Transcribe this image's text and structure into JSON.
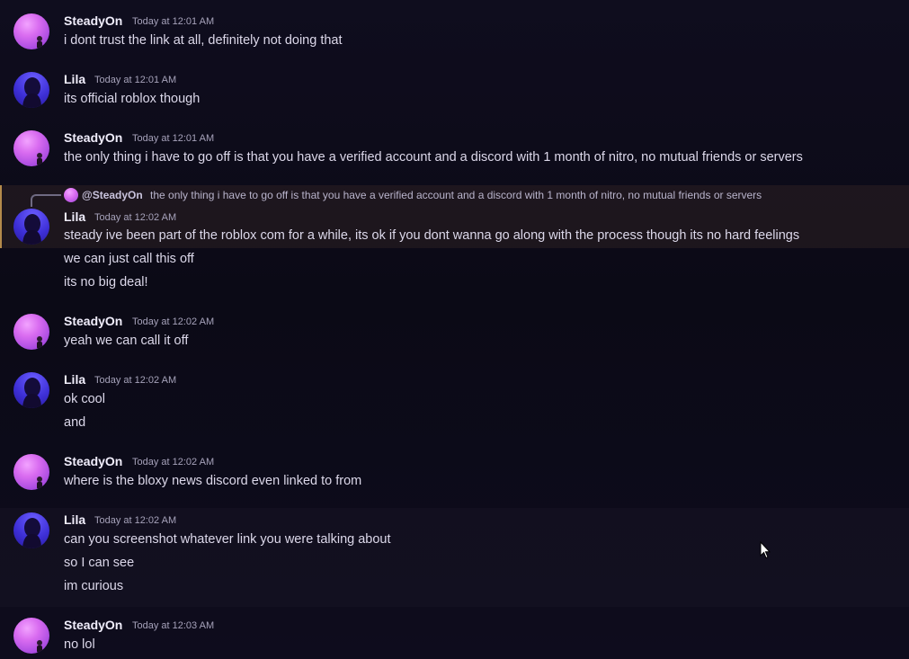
{
  "messages": [
    {
      "author": "SteadyOn",
      "time": "Today at 12:01 AM",
      "lines": [
        "i dont trust the link at all, definitely not doing that"
      ]
    },
    {
      "author": "Lila",
      "time": "Today at 12:01 AM",
      "lines": [
        "its official roblox though"
      ]
    },
    {
      "author": "SteadyOn",
      "time": "Today at 12:01 AM",
      "lines": [
        "the only thing i have to go off is that you have a verified account and a discord with 1 month of nitro, no mutual friends or servers"
      ]
    },
    {
      "author": "Lila",
      "time": "Today at 12:02 AM",
      "reply": {
        "mention": "@SteadyOn",
        "text": "the only thing i have to go off is that you have a verified account and a discord with 1 month of nitro, no mutual friends or servers"
      },
      "lines": [
        "steady ive been part of the roblox com for a while, its ok if you dont wanna go along with the process though its no hard feelings",
        "we can just call this off",
        "its no big deal!"
      ]
    },
    {
      "author": "SteadyOn",
      "time": "Today at 12:02 AM",
      "lines": [
        "yeah we can call it off"
      ]
    },
    {
      "author": "Lila",
      "time": "Today at 12:02 AM",
      "lines": [
        "ok cool",
        "and"
      ]
    },
    {
      "author": "SteadyOn",
      "time": "Today at 12:02 AM",
      "lines": [
        "where is the bloxy news discord even linked to from"
      ]
    },
    {
      "author": "Lila",
      "time": "Today at 12:02 AM",
      "lines": [
        "can you screenshot whatever link you were talking about",
        "so I can see",
        "im curious"
      ]
    },
    {
      "author": "SteadyOn",
      "time": "Today at 12:03 AM",
      "lines": [
        "no lol"
      ]
    }
  ],
  "icons": {
    "steady_avatar": "steadyon-avatar-icon",
    "lila_avatar": "lila-avatar-icon",
    "reply_connector": "reply-connector-icon",
    "cursor": "mouse-pointer-icon"
  },
  "colors": {
    "background": "#0e0c1d",
    "highlight_border": "#b48a4b",
    "steady_avatar": "#d96cf0",
    "lila_avatar": "#3d2fd6"
  }
}
